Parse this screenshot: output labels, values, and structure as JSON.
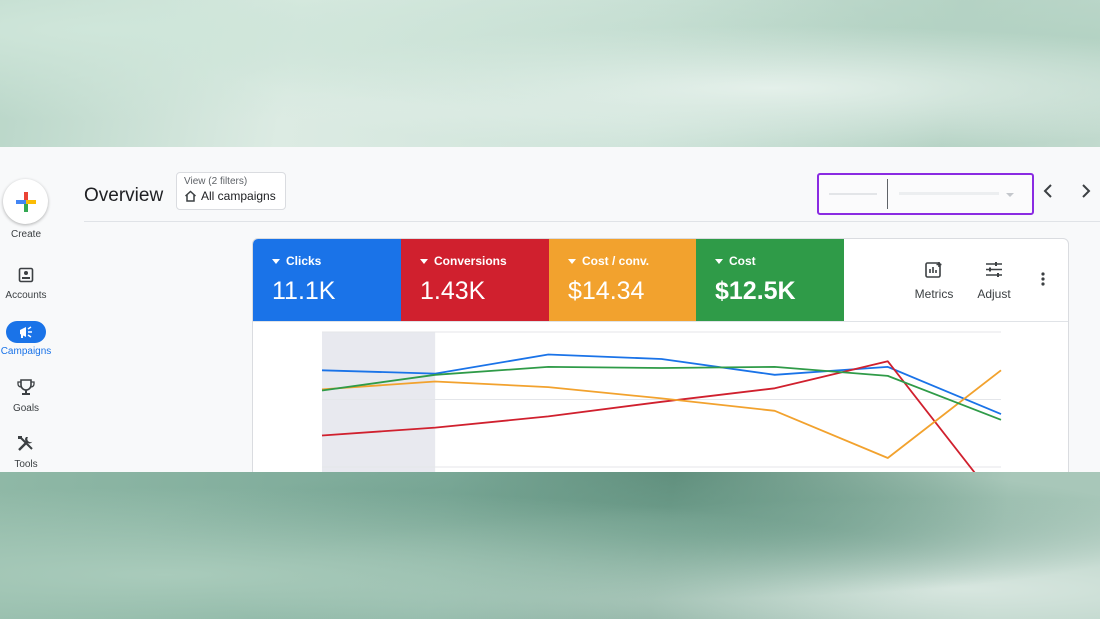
{
  "nav": {
    "create_label": "Create",
    "items": [
      {
        "label": "Accounts",
        "icon": "accounts-icon"
      },
      {
        "label": "Campaigns",
        "icon": "campaigns-icon",
        "active": true
      },
      {
        "label": "Goals",
        "icon": "goals-icon"
      },
      {
        "label": "Tools",
        "icon": "tools-icon"
      }
    ]
  },
  "header": {
    "title": "Overview",
    "view_filter": {
      "small": "View (2 filters)",
      "main": "All campaigns"
    }
  },
  "scorecards": [
    {
      "label": "Clicks",
      "value": "11.1K",
      "color": "#1a73e8"
    },
    {
      "label": "Conversions",
      "value": "1.43K",
      "color": "#d0202e"
    },
    {
      "label": "Cost / conv.",
      "value": "$14.34",
      "color": "#f2a22e"
    },
    {
      "label": "Cost",
      "value": "$12.5K",
      "color": "#2f9b48"
    }
  ],
  "toolbar": {
    "metrics_label": "Metrics",
    "adjust_label": "Adjust"
  },
  "colors": {
    "accent": "#1a73e8",
    "highlight_box": "#8a2be2"
  },
  "chart_data": {
    "type": "line",
    "x_points": 7,
    "series": [
      {
        "values": [
          0.86,
          0.83,
          1.0,
          0.96,
          0.82,
          0.89,
          0.47
        ],
        "color": "#1a73e8"
      },
      {
        "values": [
          0.28,
          0.35,
          0.45,
          0.58,
          0.7,
          0.94,
          -0.35
        ],
        "color": "#d0202e"
      },
      {
        "values": [
          0.69,
          0.76,
          0.71,
          0.61,
          0.5,
          0.08,
          0.86
        ],
        "color": "#f2a22e"
      },
      {
        "values": [
          0.68,
          0.82,
          0.89,
          0.88,
          0.89,
          0.81,
          0.42
        ],
        "color": "#2f9b48"
      }
    ],
    "y_range": [
      0,
      1.2
    ]
  }
}
